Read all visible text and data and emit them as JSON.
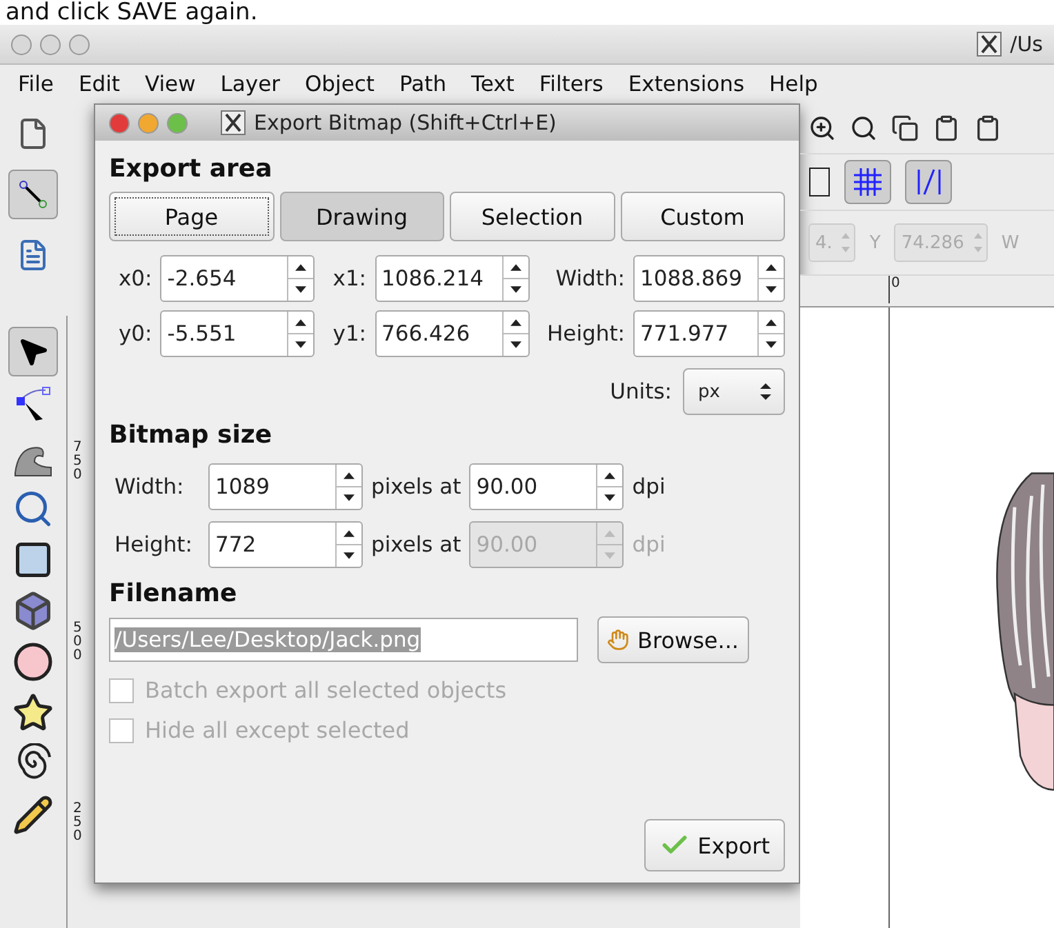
{
  "caption": "and click SAVE again.",
  "window": {
    "title": "/Us"
  },
  "menu": [
    "File",
    "Edit",
    "View",
    "Layer",
    "Object",
    "Path",
    "Text",
    "Filters",
    "Extensions",
    "Help"
  ],
  "snap_toolbar": {
    "grid_on": true,
    "guides_on": true
  },
  "coords_toolbar": {
    "x_value": "4.",
    "y_label": "Y",
    "y_value": "74.286",
    "w_label": "W"
  },
  "rulers": {
    "horizontal": [
      "0"
    ],
    "vertical": [
      "750",
      "500",
      "250"
    ]
  },
  "dialog": {
    "title": "Export Bitmap (Shift+Ctrl+E)",
    "export_area": {
      "heading": "Export area",
      "buttons": [
        {
          "label": "Page",
          "selected": false,
          "focused": true
        },
        {
          "label": "Drawing",
          "selected": true,
          "focused": false
        },
        {
          "label": "Selection",
          "selected": false,
          "focused": false
        },
        {
          "label": "Custom",
          "selected": false,
          "focused": false
        }
      ],
      "fields": [
        {
          "label": "x0:",
          "value": "-2.654"
        },
        {
          "label": "x1:",
          "value": "1086.214"
        },
        {
          "label": "Width:",
          "value": "1088.869"
        },
        {
          "label": "y0:",
          "value": "-5.551"
        },
        {
          "label": "y1:",
          "value": "766.426"
        },
        {
          "label": "Height:",
          "value": "771.977"
        }
      ],
      "units_label": "Units:",
      "units_value": "px"
    },
    "bitmap_size": {
      "heading": "Bitmap size",
      "rows": [
        {
          "label": "Width:",
          "value": "1089",
          "between": "pixels at",
          "dpi": "90.00",
          "dpi_unit": "dpi",
          "dpi_disabled": false
        },
        {
          "label": "Height:",
          "value": "772",
          "between": "pixels at",
          "dpi": "90.00",
          "dpi_unit": "dpi",
          "dpi_disabled": true
        }
      ]
    },
    "filename": {
      "heading": "Filename",
      "value": "/Users/Lee/Desktop/Jack.png",
      "browse": "Browse..."
    },
    "options": [
      {
        "label": "Batch export all selected objects",
        "checked": false,
        "disabled": true
      },
      {
        "label": "Hide all except selected",
        "checked": false,
        "disabled": true
      }
    ],
    "export_button": "Export"
  }
}
